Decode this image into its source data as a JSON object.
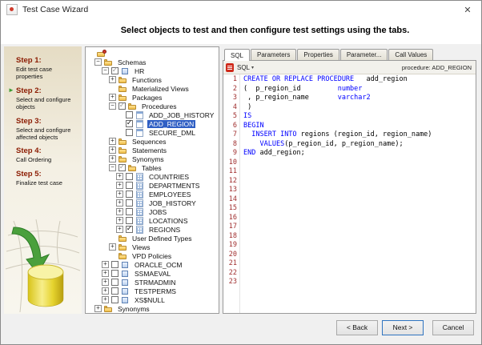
{
  "window": {
    "title": "Test Case Wizard",
    "close": "✕"
  },
  "header": {
    "instruction": "Select objects to test and then configure test settings using the tabs."
  },
  "colors": {
    "accent_green": "#3d9b33",
    "step_heading": "#8b1a00",
    "selection_bg": "#2f5fc4",
    "keyword_blue": "#0000ff",
    "line_number_red": "#a03030"
  },
  "steps": [
    {
      "title": "Step 1:",
      "desc": "Edit test case properties",
      "current": false
    },
    {
      "title": "Step 2:",
      "desc": "Select and configure objects",
      "current": true
    },
    {
      "title": "Step 3:",
      "desc": "Select and configure affected objects",
      "current": false
    },
    {
      "title": "Step 4:",
      "desc": "Call Ordering",
      "current": false
    },
    {
      "title": "Step 5:",
      "desc": "Finalize test case",
      "current": false
    }
  ],
  "tree": {
    "items": [
      {
        "label": "",
        "depth": 0,
        "icon": "root",
        "exp": null,
        "chk": null
      },
      {
        "label": "Schemas",
        "depth": 1,
        "icon": "folder",
        "exp": "-",
        "chk": null
      },
      {
        "label": "HR",
        "depth": 2,
        "icon": "schema",
        "exp": "-",
        "chk": "partial"
      },
      {
        "label": "Functions",
        "depth": 3,
        "icon": "folder",
        "exp": "+",
        "chk": null
      },
      {
        "label": "Materialized Views",
        "depth": 3,
        "icon": "folder",
        "exp": null,
        "chk": null
      },
      {
        "label": "Packages",
        "depth": 3,
        "icon": "folder",
        "exp": "+",
        "chk": null
      },
      {
        "label": "Procedures",
        "depth": 3,
        "icon": "folderopen",
        "exp": "-",
        "chk": "partial"
      },
      {
        "label": "ADD_JOB_HISTORY",
        "depth": 4,
        "icon": "proc",
        "exp": null,
        "chk": "unchecked"
      },
      {
        "label": "ADD_REGION",
        "depth": 4,
        "icon": "proc",
        "exp": null,
        "chk": "checked",
        "sel": true
      },
      {
        "label": "SECURE_DML",
        "depth": 4,
        "icon": "proc",
        "exp": null,
        "chk": "unchecked"
      },
      {
        "label": "Sequences",
        "depth": 3,
        "icon": "folder",
        "exp": "+",
        "chk": null
      },
      {
        "label": "Statements",
        "depth": 3,
        "icon": "folder",
        "exp": "+",
        "chk": null
      },
      {
        "label": "Synonyms",
        "depth": 3,
        "icon": "folder",
        "exp": "+",
        "chk": null
      },
      {
        "label": "Tables",
        "depth": 3,
        "icon": "folderopen",
        "exp": "-",
        "chk": "partial"
      },
      {
        "label": "COUNTRIES",
        "depth": 4,
        "icon": "table",
        "exp": "+",
        "chk": "unchecked"
      },
      {
        "label": "DEPARTMENTS",
        "depth": 4,
        "icon": "table",
        "exp": "+",
        "chk": "unchecked"
      },
      {
        "label": "EMPLOYEES",
        "depth": 4,
        "icon": "table",
        "exp": "+",
        "chk": "unchecked"
      },
      {
        "label": "JOB_HISTORY",
        "depth": 4,
        "icon": "table",
        "exp": "+",
        "chk": "unchecked"
      },
      {
        "label": "JOBS",
        "depth": 4,
        "icon": "table",
        "exp": "+",
        "chk": "unchecked"
      },
      {
        "label": "LOCATIONS",
        "depth": 4,
        "icon": "table",
        "exp": "+",
        "chk": "unchecked"
      },
      {
        "label": "REGIONS",
        "depth": 4,
        "icon": "table",
        "exp": "+",
        "chk": "checked"
      },
      {
        "label": "User Defined Types",
        "depth": 3,
        "icon": "folder",
        "exp": null,
        "chk": null
      },
      {
        "label": "Views",
        "depth": 3,
        "icon": "folder",
        "exp": "+",
        "chk": null
      },
      {
        "label": "VPD Policies",
        "depth": 3,
        "icon": "folder",
        "exp": null,
        "chk": null
      },
      {
        "label": "ORACLE_OCM",
        "depth": 2,
        "icon": "schema",
        "exp": "+",
        "chk": "unchecked"
      },
      {
        "label": "SSMAEVAL",
        "depth": 2,
        "icon": "schema",
        "exp": "+",
        "chk": "unchecked"
      },
      {
        "label": "STRMADMIN",
        "depth": 2,
        "icon": "schema",
        "exp": "+",
        "chk": "unchecked"
      },
      {
        "label": "TESTPERMS",
        "depth": 2,
        "icon": "schema",
        "exp": "+",
        "chk": "unchecked"
      },
      {
        "label": "XS$NULL",
        "depth": 2,
        "icon": "schema",
        "exp": "+",
        "chk": "unchecked"
      },
      {
        "label": "Synonyms",
        "depth": 1,
        "icon": "folder",
        "exp": "+",
        "chk": null
      }
    ]
  },
  "editor": {
    "tabs": [
      "SQL",
      "Parameters",
      "Properties",
      "Parameter...",
      "Call Values"
    ],
    "active_tab": "SQL",
    "toolbar": {
      "dropdown": "SQL",
      "object": "procedure: ADD_REGION"
    },
    "total_lines": 23,
    "lines": [
      [
        [
          "CREATE OR REPLACE PROCEDURE",
          1
        ],
        [
          "   add_region",
          0
        ]
      ],
      [
        [
          "(  p_region_id         ",
          0
        ],
        [
          "number",
          1
        ]
      ],
      [
        [
          " , p_region_name       ",
          0
        ],
        [
          "varchar2",
          1
        ]
      ],
      [
        [
          " )",
          0
        ]
      ],
      [
        [
          "IS",
          1
        ]
      ],
      [
        [
          "BEGIN",
          1
        ]
      ],
      [
        [
          "  ",
          0
        ],
        [
          "INSERT INTO",
          1
        ],
        [
          " regions (region_id, region_name)",
          0
        ]
      ],
      [
        [
          "    ",
          0
        ],
        [
          "VALUES",
          1
        ],
        [
          "(p_region_id, p_region_name);",
          0
        ]
      ],
      [
        [
          "END",
          1
        ],
        [
          " add_region;",
          0
        ]
      ]
    ]
  },
  "footer": {
    "back": "< Back",
    "next": "Next >",
    "cancel": "Cancel"
  }
}
